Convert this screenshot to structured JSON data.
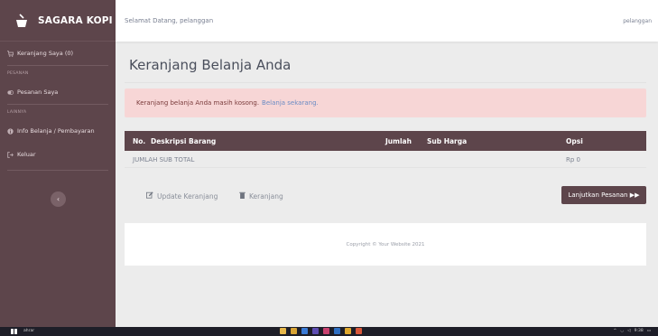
{
  "brand": {
    "name": "SAGARA KOPI"
  },
  "sidebar": {
    "cart_item": "Keranjang Saya (0)",
    "heading_orders": "PESANAN",
    "orders_item": "Pesanan Saya",
    "heading_other": "LAINNYA",
    "info_item": "Info Belanja / Pembayaran",
    "logout_item": "Keluar",
    "collapse_glyph": "‹"
  },
  "topbar": {
    "greeting": "Selamat Datang, pelanggan",
    "username": "pelanggan"
  },
  "page": {
    "title": "Keranjang Belanja Anda",
    "alert_text": "Keranjang belanja Anda masih kosong.",
    "alert_link": "Belanja sekarang."
  },
  "table": {
    "headers": {
      "no": "No.",
      "desc": "Deskripsi Barang",
      "qty": "Jumlah",
      "subtotal": "Sub Harga",
      "options": "Opsi"
    },
    "total_label": "JUMLAH SUB TOTAL",
    "total_value": "Rp 0"
  },
  "actions": {
    "update_label": "Update Keranjang",
    "clear_label": "Keranjang",
    "next_label": "Lanjutkan Pesanan ▶▶"
  },
  "footer": {
    "copyright": "Copyright © Your Website 2021"
  },
  "taskbar": {
    "search_text": "ahrar",
    "clock": "9:38"
  },
  "colors": {
    "accent": "#5d454b",
    "alert_bg": "#f7d6d6",
    "link": "#6b8cc4"
  }
}
